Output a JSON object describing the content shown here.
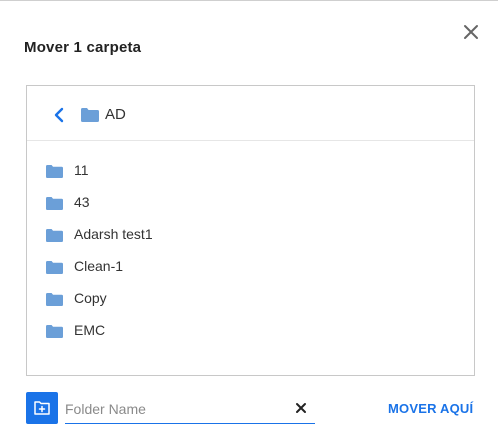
{
  "dialog": {
    "title": "Mover 1 carpeta",
    "close_icon": "close-icon"
  },
  "panel": {
    "current_folder": "AD",
    "back_icon": "chevron-left-icon",
    "folder_icon": "folder-icon",
    "items": [
      {
        "label": "11"
      },
      {
        "label": "43"
      },
      {
        "label": "Adarsh test1"
      },
      {
        "label": "Clean-1"
      },
      {
        "label": "Copy"
      },
      {
        "label": "EMC"
      }
    ]
  },
  "footer": {
    "new_folder_icon": "new-folder-icon",
    "folder_name_placeholder": "Folder Name",
    "folder_name_value": "",
    "clear_icon": "clear-icon",
    "move_label": "MOVER AQUÍ"
  },
  "colors": {
    "accent": "#1a73e8",
    "folder": "#6b9fd8",
    "text": "#333333"
  }
}
